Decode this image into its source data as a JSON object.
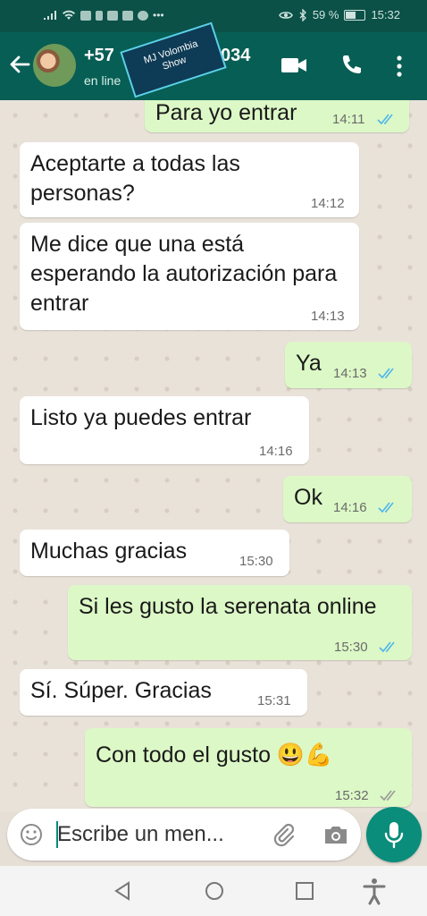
{
  "statusbar": {
    "battery": "59 %",
    "battery_level": 0.59,
    "time": "15:32"
  },
  "header": {
    "contact_prefix": "+57",
    "contact_suffix": "034",
    "status": "en line",
    "watermark_line1": "MJ Volombia",
    "watermark_line2": "Show"
  },
  "messages": [
    {
      "dir": "out",
      "text": "Para yo entrar",
      "time": "14:11",
      "read": true
    },
    {
      "dir": "in",
      "text": "Aceptarte a todas las personas?",
      "time": "14:12"
    },
    {
      "dir": "in",
      "text": "Me dice que una está esperando la autorización para entrar",
      "time": "14:13"
    },
    {
      "dir": "out",
      "text": "Ya",
      "time": "14:13",
      "read": true
    },
    {
      "dir": "in",
      "text": "Listo ya puedes entrar",
      "time": "14:16"
    },
    {
      "dir": "out",
      "text": "Ok",
      "time": "14:16",
      "read": true
    },
    {
      "dir": "in",
      "text": "Muchas gracias",
      "time": "15:30"
    },
    {
      "dir": "out",
      "text": "Si les gusto la serenata online",
      "time": "15:30",
      "read": true
    },
    {
      "dir": "in",
      "text": "Sí. Súper. Gracias",
      "time": "15:31"
    },
    {
      "dir": "out",
      "text": "Con todo el gusto 😃💪",
      "time": "15:32",
      "read": false
    }
  ],
  "composer": {
    "placeholder": "Escribe un men..."
  },
  "colors": {
    "header": "#075e54",
    "outgoing": "#dcf8c6",
    "incoming": "#ffffff",
    "read_ticks": "#4fb6ec",
    "fab": "#0a8d7b"
  }
}
